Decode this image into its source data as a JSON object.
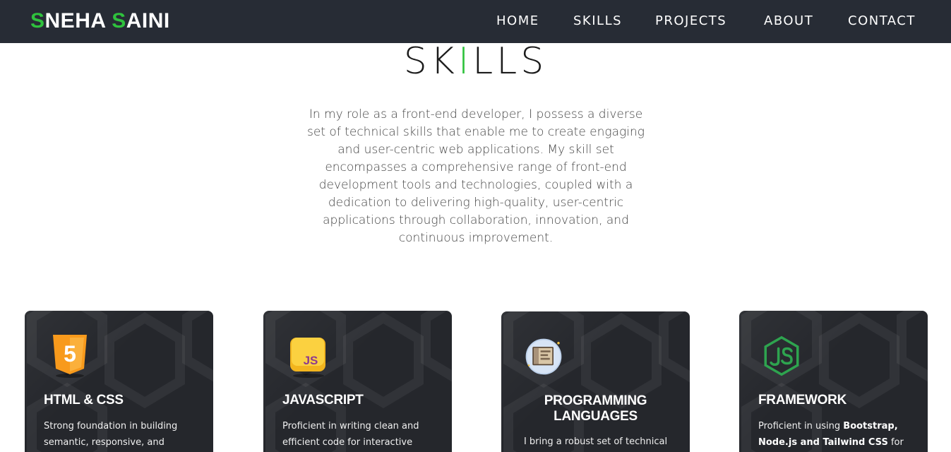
{
  "nav": {
    "logo_first_initial": "S",
    "logo_first_rest": "NEHA ",
    "logo_last_initial": "S",
    "logo_last_rest": "AINI",
    "links": [
      "HOME",
      "SKILLS",
      "PROJECTS",
      "ABOUT",
      "CONTACT"
    ]
  },
  "skills_section": {
    "title_part1": "SK",
    "title_accent": "I",
    "title_part2": "LLS",
    "intro": "In my role as a front-end developer, I possess a diverse set of technical skills that enable me to create engaging and user-centric web applications. My skill set encompasses a comprehensive range of front-end development tools and technologies, coupled with a dedication to delivering high-quality, user-centric applications through collaboration, innovation, and continuous improvement."
  },
  "cards": [
    {
      "icon": "html5-icon",
      "icon_text": "5",
      "title": "HTML & CSS",
      "desc": "Strong foundation in building semantic, responsive, and"
    },
    {
      "icon": "javascript-icon",
      "icon_text": "JS",
      "title": "JAVASCRIPT",
      "desc": "Proficient in writing clean and efficient code for interactive"
    },
    {
      "icon": "code-window-icon",
      "title_line1": "PROGRAMMING",
      "title_line2": "LANGUAGES",
      "desc": "I bring a robust set of technical"
    },
    {
      "icon": "nodejs-icon",
      "title": "FRAMEWORK",
      "desc_prefix": "Proficient in using ",
      "desc_bold": "Bootstrap, Node.js and Tailwind CSS",
      "desc_suffix": " for"
    }
  ],
  "colors": {
    "accent": "#2fc23d",
    "navbar": "#272c35",
    "card": "#25272c"
  }
}
